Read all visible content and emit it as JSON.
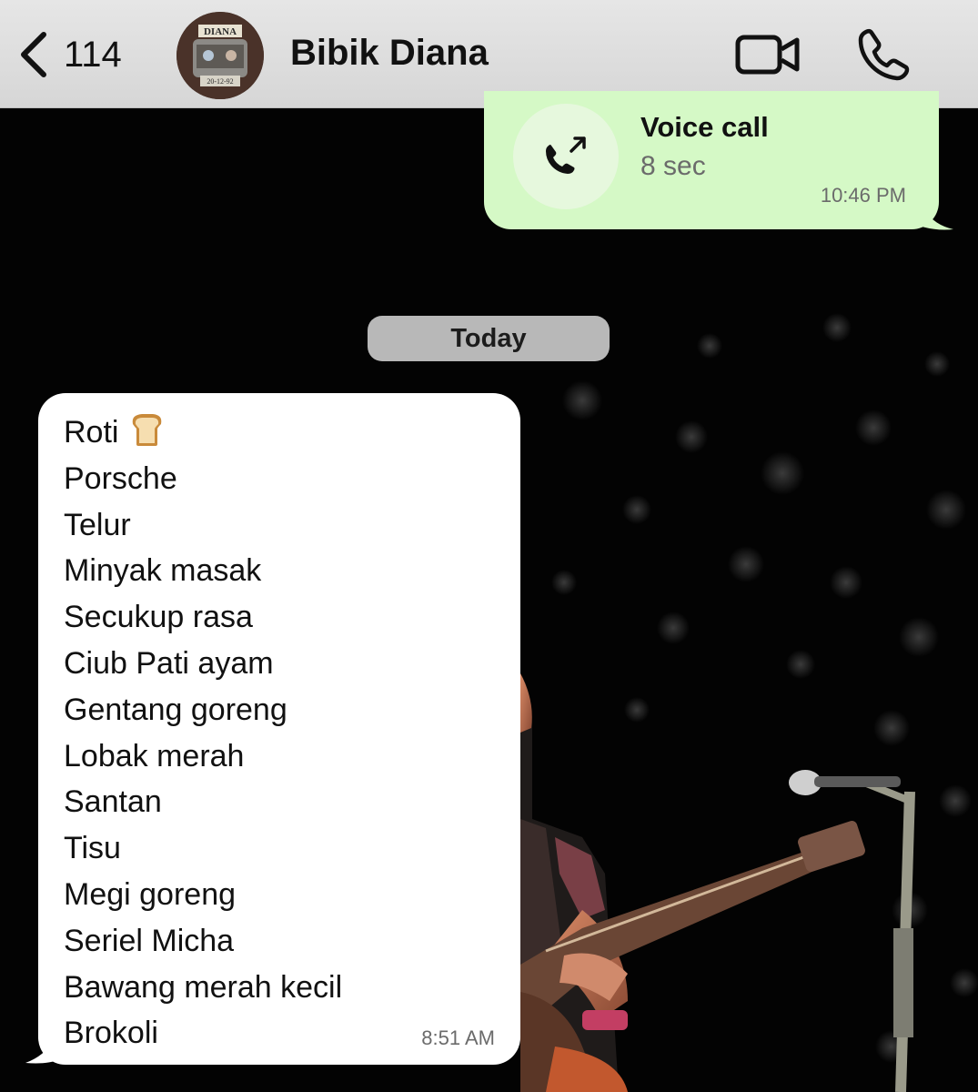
{
  "header": {
    "back_count": "114",
    "contact_name": "Bibik Diana",
    "avatar_text": "DIANA",
    "avatar_date": "20-12-92"
  },
  "call": {
    "title": "Voice call",
    "duration": "8 sec",
    "time": "10:46 PM"
  },
  "date_separator": "Today",
  "message": {
    "lines": [
      "Roti",
      "Porsche",
      "Telur",
      "Minyak masak",
      "Secukup rasa",
      "Ciub Pati ayam",
      "Gentang goreng",
      "Lobak merah",
      "Santan",
      "Tisu",
      "Megi goreng",
      "Seriel Micha",
      "Bawang merah kecil",
      "Brokoli"
    ],
    "emoji": "bread",
    "time": "8:51 AM"
  },
  "colors": {
    "header_bg": "#dcdcdc",
    "outgoing_bubble": "#d5f9c6",
    "incoming_bubble": "#ffffff",
    "date_pill": "#b8b8b8",
    "background": "#000000"
  }
}
